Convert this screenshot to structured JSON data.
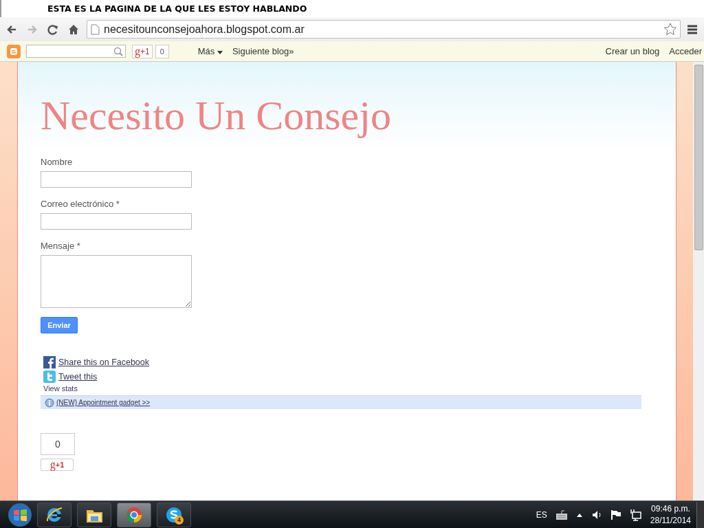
{
  "caption": "ESTA ES LA PAGINA DE LA QUE LES ESTOY HABLANDO",
  "browser": {
    "url": "necesitounconsejoahora.blogspot.com.ar"
  },
  "navbar": {
    "plus_one": {
      "logo": "g",
      "label": "+1",
      "count": "0"
    },
    "links": [
      "Más",
      "Siguiente blog»"
    ],
    "right_links": [
      "Crear un blog",
      "Acceder"
    ]
  },
  "blog": {
    "title": "Necesito Un Consejo",
    "form": [
      {
        "label": "Nombre",
        "kind": "input"
      },
      {
        "label": "Correo electrónico *",
        "kind": "input"
      },
      {
        "label": "Mensaje *",
        "kind": "textarea"
      }
    ],
    "submit": "Enviar",
    "share": [
      {
        "kind": "facebook",
        "label": "Share this on Facebook"
      },
      {
        "kind": "twitter",
        "label": "Tweet this"
      }
    ],
    "view_stats": "View stats",
    "notice": "(NEW) Appointment gadget >>",
    "plus_one": {
      "count": "0",
      "logo": "g",
      "label": "+1"
    }
  },
  "taskbar": {
    "apps": [
      {
        "kind": "ie",
        "selected": false
      },
      {
        "kind": "folder",
        "selected": false
      },
      {
        "kind": "chrome",
        "selected": true
      },
      {
        "kind": "skype",
        "selected": false,
        "badge": "4"
      }
    ],
    "tray": {
      "language": "ES",
      "time": "09:46 p.m.",
      "date": "28/11/2014"
    }
  }
}
